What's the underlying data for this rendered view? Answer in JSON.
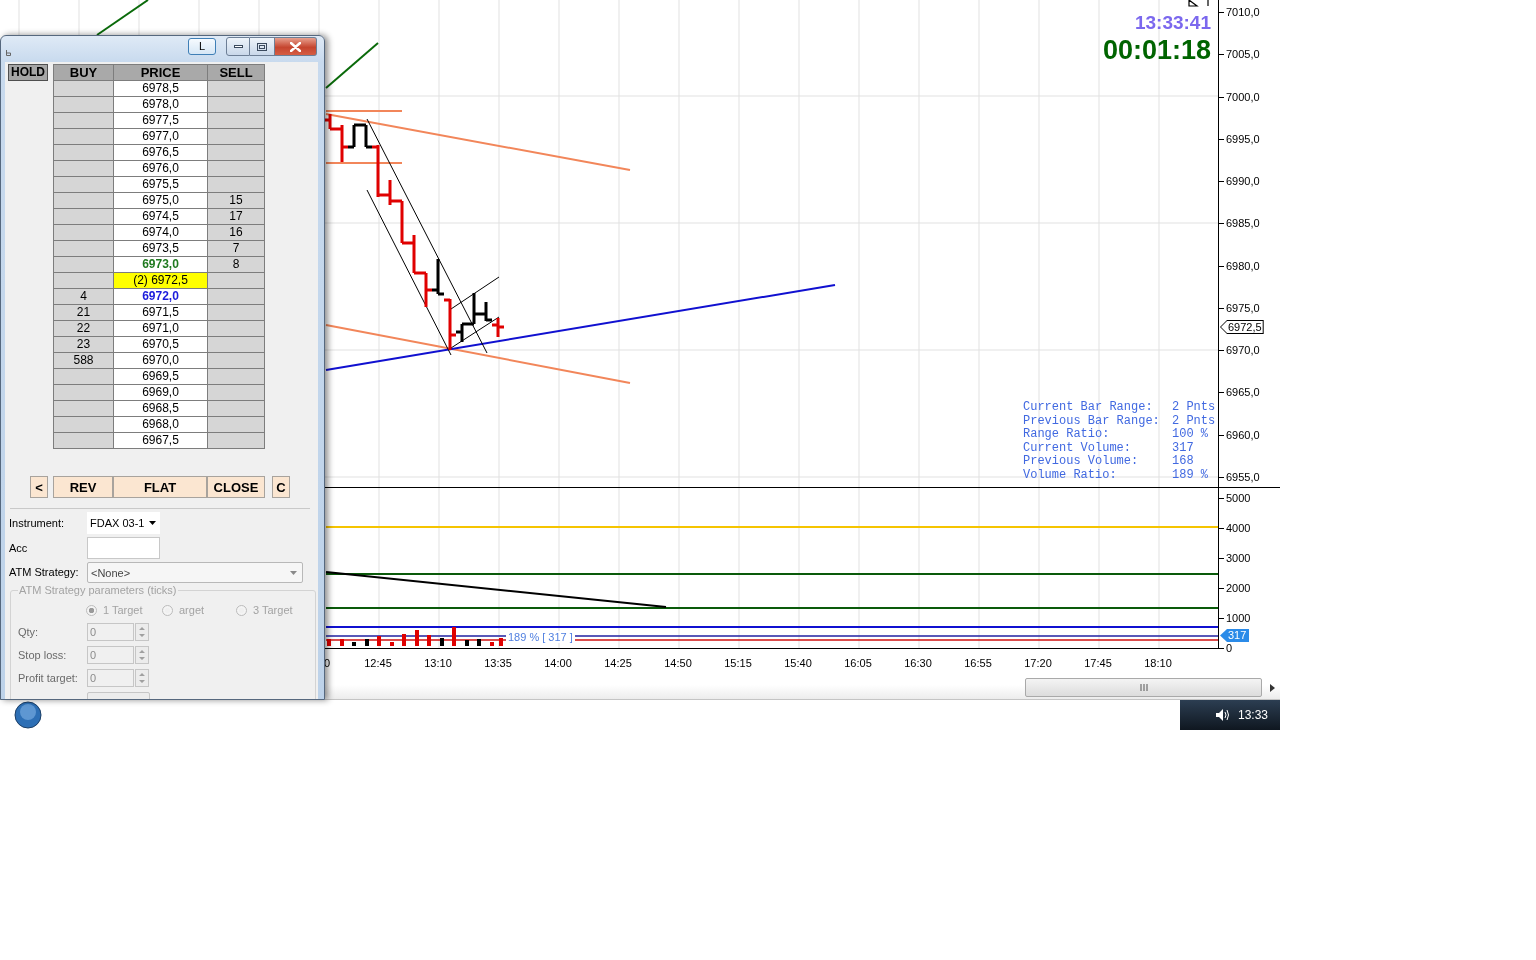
{
  "dom_window": {
    "lock_button": "L",
    "columns": [
      "HOLD",
      "BUY",
      "PRICE",
      "SELL"
    ],
    "rows": [
      {
        "price": "6978,5",
        "kind": "normal"
      },
      {
        "price": "6978,0",
        "kind": "normal"
      },
      {
        "price": "6977,5",
        "kind": "normal"
      },
      {
        "price": "6977,0",
        "kind": "normal"
      },
      {
        "price": "6976,5",
        "kind": "normal"
      },
      {
        "price": "6976,0",
        "kind": "normal"
      },
      {
        "price": "6975,5",
        "kind": "normal"
      },
      {
        "price": "6975,0",
        "sell": "15",
        "kind": "normal"
      },
      {
        "price": "6974,5",
        "sell": "17",
        "kind": "normal"
      },
      {
        "price": "6974,0",
        "sell": "16",
        "kind": "normal"
      },
      {
        "price": "6973,5",
        "sell": "7",
        "kind": "normal"
      },
      {
        "price": "6973,0",
        "sell": "8",
        "kind": "ask"
      },
      {
        "price": "(2) 6972,5",
        "kind": "last"
      },
      {
        "price": "6972,0",
        "buy": "4",
        "kind": "bid"
      },
      {
        "price": "6971,5",
        "buy": "21",
        "kind": "normal"
      },
      {
        "price": "6971,0",
        "buy": "22",
        "kind": "normal"
      },
      {
        "price": "6970,5",
        "buy": "23",
        "kind": "normal"
      },
      {
        "price": "6970,0",
        "buy": "588",
        "kind": "normal"
      },
      {
        "price": "6969,5",
        "kind": "normal"
      },
      {
        "price": "6969,0",
        "kind": "normal"
      },
      {
        "price": "6968,5",
        "kind": "normal"
      },
      {
        "price": "6968,0",
        "kind": "normal"
      },
      {
        "price": "6967,5",
        "kind": "normal"
      }
    ],
    "actions": {
      "left": "<",
      "main": [
        "REV",
        "FLAT",
        "CLOSE"
      ],
      "right": "C"
    },
    "instrument": {
      "label": "Instrument:",
      "value": "FDAX 03-1"
    },
    "account": {
      "label": "Acc"
    },
    "atm_strategy": {
      "label": "ATM Strategy:",
      "value": "<None>"
    },
    "atm_parameters": {
      "title": "ATM Strategy parameters (ticks)",
      "disabled": true,
      "targets": [
        {
          "label": "1 Target",
          "selected": true
        },
        {
          "label": "arget",
          "selected": false
        },
        {
          "label": "3 Target",
          "selected": false
        }
      ],
      "fields": [
        {
          "label": "Qty:",
          "value": "0"
        },
        {
          "label": "Stop loss:",
          "value": "0"
        },
        {
          "label": "Profit target:",
          "value": "0"
        }
      ]
    }
  },
  "chart": {
    "clock": "13:33:41",
    "bar_timer": "00:01:18",
    "price_axis": [
      "7010,0",
      "7005,0",
      "7000,0",
      "6995,0",
      "6990,0",
      "6985,0",
      "6980,0",
      "6975,0",
      "6970,0",
      "6965,0",
      "6960,0",
      "6955,0"
    ],
    "price_marker": "6972,5",
    "stats": [
      {
        "label": "Current Bar Range:",
        "value": "2 Pnts"
      },
      {
        "label": "Previous Bar Range:",
        "value": "2 Pnts"
      },
      {
        "label": "Range Ratio:",
        "value": "100 %"
      },
      {
        "label": "Current Volume:",
        "value": "317"
      },
      {
        "label": "Previous Volume:",
        "value": "168"
      },
      {
        "label": "Volume Ratio:",
        "value": "189 %"
      }
    ],
    "volume_axis": [
      "5000",
      "4000",
      "3000",
      "2000",
      "1000",
      "0"
    ],
    "volume_label": "189 % [ 317 ]",
    "volume_marker": "317",
    "time_axis": [
      "0",
      "12:45",
      "13:10",
      "13:35",
      "14:00",
      "14:25",
      "14:50",
      "15:15",
      "15:40",
      "16:05",
      "16:30",
      "16:55",
      "17:20",
      "17:45",
      "18:10"
    ]
  },
  "taskbar": {
    "clock": "13:33"
  }
}
